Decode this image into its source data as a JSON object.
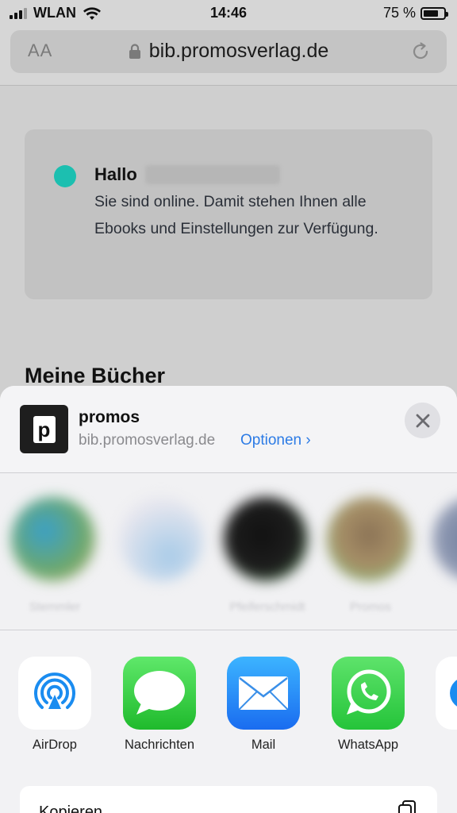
{
  "status_bar": {
    "carrier": "WLAN",
    "time": "14:46",
    "battery": "75 %",
    "battery_level": 0.75
  },
  "browser": {
    "text_size_label": "AA",
    "url": "bib.promosverlag.de"
  },
  "page": {
    "greeting": "Hallo",
    "status_message": "Sie sind online. Damit stehen Ihnen alle Ebooks und Einstellungen zur Verfügung.",
    "section_title": "Meine Bücher",
    "online_color": "#1cbfb0"
  },
  "share_sheet": {
    "site_name": "promos",
    "site_icon_letter": "p",
    "site_url": "bib.promosverlag.de",
    "options_label": "Optionen ›",
    "contacts": [
      {
        "name": "Stemmler"
      },
      {
        "name": ""
      },
      {
        "name": "Pfeiferschmidt"
      },
      {
        "name": "Promos"
      }
    ],
    "apps": [
      {
        "label": "AirDrop",
        "icon": "airdrop-icon"
      },
      {
        "label": "Nachrichten",
        "icon": "messages-icon"
      },
      {
        "label": "Mail",
        "icon": "mail-icon"
      },
      {
        "label": "WhatsApp",
        "icon": "whatsapp-icon"
      }
    ],
    "action_label": "Kopieren",
    "accent_color": "#2c7be5"
  }
}
